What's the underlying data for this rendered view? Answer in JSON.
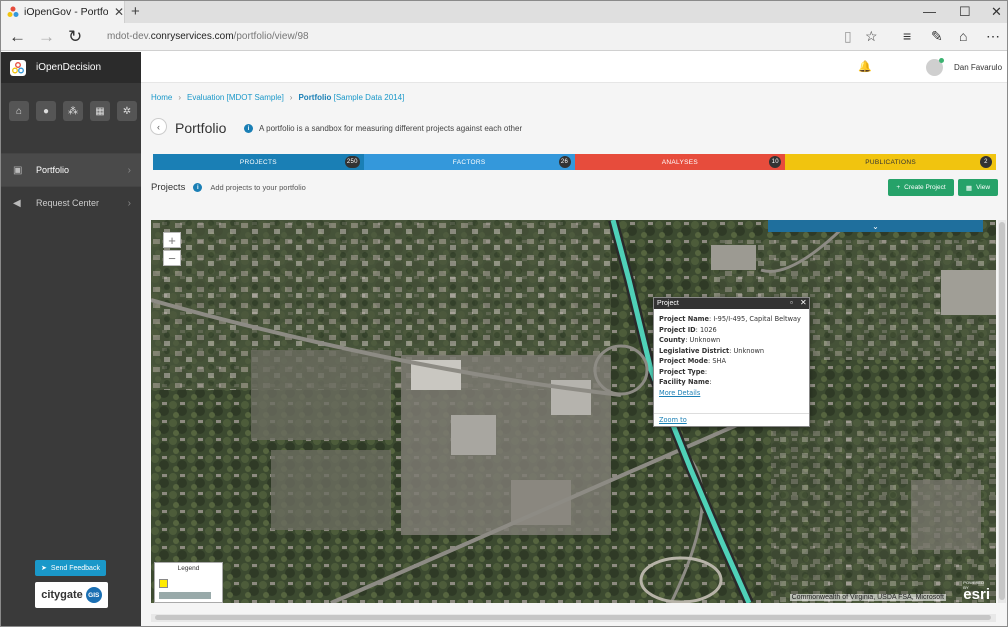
{
  "browser": {
    "tab_title": "iOpenGov - Portfolio Vi",
    "url_prefix": "mdot-dev.",
    "url_domain": "conryservices.com",
    "url_path": "/portfolio/view/98"
  },
  "sidebar": {
    "app_name": "iOpenDecision",
    "items": [
      {
        "label": "Portfolio",
        "icon": "briefcase-icon"
      },
      {
        "label": "Request Center",
        "icon": "megaphone-icon"
      }
    ],
    "feedback_label": "Send Feedback",
    "logo_text": "citygate",
    "logo_badge": "GIS"
  },
  "header": {
    "user_name": "Dan Favarulo"
  },
  "breadcrumb": {
    "home": "Home",
    "evaluation": "Evaluation [MDOT Sample]",
    "current": "Portfolio",
    "current_detail": "[Sample Data 2014]"
  },
  "page": {
    "title": "Portfolio",
    "description": "A portfolio is a sandbox for measuring different projects against each other"
  },
  "tabs": [
    {
      "label": "PROJECTS",
      "count": "250",
      "color": "#1a7fb5"
    },
    {
      "label": "FACTORS",
      "count": "26",
      "color": "#3498db"
    },
    {
      "label": "ANALYSES",
      "count": "10",
      "color": "#e74c3c"
    },
    {
      "label": "PUBLICATIONS",
      "count": "2",
      "color": "#f1c40f"
    }
  ],
  "projects_section": {
    "title": "Projects",
    "subtitle": "Add projects to your portfolio",
    "create_button": "Create Project",
    "view_button": "View"
  },
  "popup": {
    "title": "Project",
    "fields": [
      {
        "label": "Project Name",
        "value": "I-95/I-495, Capital Beltway"
      },
      {
        "label": "Project ID",
        "value": "1026"
      },
      {
        "label": "County",
        "value": "Unknown"
      },
      {
        "label": "Legislative District",
        "value": "Unknown"
      },
      {
        "label": "Project Mode",
        "value": "SHA"
      },
      {
        "label": "Project Type",
        "value": ""
      },
      {
        "label": "Facility Name",
        "value": ""
      }
    ],
    "more_details": "More Details",
    "zoom_to": "Zoom to"
  },
  "map": {
    "legend_title": "Legend",
    "credit": "Commonwealth of Virginia, USDA FSA, Microsoft",
    "esri_label": "esri",
    "esri_powered": "POWERED BY",
    "zoom_in": "+",
    "zoom_out": "−"
  }
}
